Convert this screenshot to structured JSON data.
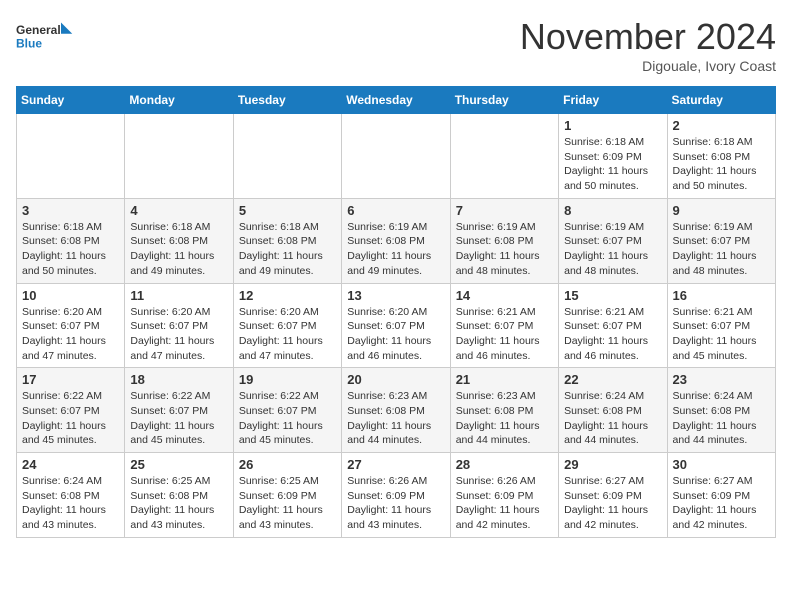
{
  "header": {
    "logo_line1": "General",
    "logo_line2": "Blue",
    "month": "November 2024",
    "location": "Digouale, Ivory Coast"
  },
  "days_of_week": [
    "Sunday",
    "Monday",
    "Tuesday",
    "Wednesday",
    "Thursday",
    "Friday",
    "Saturday"
  ],
  "weeks": [
    [
      {
        "day": "",
        "info": ""
      },
      {
        "day": "",
        "info": ""
      },
      {
        "day": "",
        "info": ""
      },
      {
        "day": "",
        "info": ""
      },
      {
        "day": "",
        "info": ""
      },
      {
        "day": "1",
        "info": "Sunrise: 6:18 AM\nSunset: 6:09 PM\nDaylight: 11 hours\nand 50 minutes."
      },
      {
        "day": "2",
        "info": "Sunrise: 6:18 AM\nSunset: 6:08 PM\nDaylight: 11 hours\nand 50 minutes."
      }
    ],
    [
      {
        "day": "3",
        "info": "Sunrise: 6:18 AM\nSunset: 6:08 PM\nDaylight: 11 hours\nand 50 minutes."
      },
      {
        "day": "4",
        "info": "Sunrise: 6:18 AM\nSunset: 6:08 PM\nDaylight: 11 hours\nand 49 minutes."
      },
      {
        "day": "5",
        "info": "Sunrise: 6:18 AM\nSunset: 6:08 PM\nDaylight: 11 hours\nand 49 minutes."
      },
      {
        "day": "6",
        "info": "Sunrise: 6:19 AM\nSunset: 6:08 PM\nDaylight: 11 hours\nand 49 minutes."
      },
      {
        "day": "7",
        "info": "Sunrise: 6:19 AM\nSunset: 6:08 PM\nDaylight: 11 hours\nand 48 minutes."
      },
      {
        "day": "8",
        "info": "Sunrise: 6:19 AM\nSunset: 6:07 PM\nDaylight: 11 hours\nand 48 minutes."
      },
      {
        "day": "9",
        "info": "Sunrise: 6:19 AM\nSunset: 6:07 PM\nDaylight: 11 hours\nand 48 minutes."
      }
    ],
    [
      {
        "day": "10",
        "info": "Sunrise: 6:20 AM\nSunset: 6:07 PM\nDaylight: 11 hours\nand 47 minutes."
      },
      {
        "day": "11",
        "info": "Sunrise: 6:20 AM\nSunset: 6:07 PM\nDaylight: 11 hours\nand 47 minutes."
      },
      {
        "day": "12",
        "info": "Sunrise: 6:20 AM\nSunset: 6:07 PM\nDaylight: 11 hours\nand 47 minutes."
      },
      {
        "day": "13",
        "info": "Sunrise: 6:20 AM\nSunset: 6:07 PM\nDaylight: 11 hours\nand 46 minutes."
      },
      {
        "day": "14",
        "info": "Sunrise: 6:21 AM\nSunset: 6:07 PM\nDaylight: 11 hours\nand 46 minutes."
      },
      {
        "day": "15",
        "info": "Sunrise: 6:21 AM\nSunset: 6:07 PM\nDaylight: 11 hours\nand 46 minutes."
      },
      {
        "day": "16",
        "info": "Sunrise: 6:21 AM\nSunset: 6:07 PM\nDaylight: 11 hours\nand 45 minutes."
      }
    ],
    [
      {
        "day": "17",
        "info": "Sunrise: 6:22 AM\nSunset: 6:07 PM\nDaylight: 11 hours\nand 45 minutes."
      },
      {
        "day": "18",
        "info": "Sunrise: 6:22 AM\nSunset: 6:07 PM\nDaylight: 11 hours\nand 45 minutes."
      },
      {
        "day": "19",
        "info": "Sunrise: 6:22 AM\nSunset: 6:07 PM\nDaylight: 11 hours\nand 45 minutes."
      },
      {
        "day": "20",
        "info": "Sunrise: 6:23 AM\nSunset: 6:08 PM\nDaylight: 11 hours\nand 44 minutes."
      },
      {
        "day": "21",
        "info": "Sunrise: 6:23 AM\nSunset: 6:08 PM\nDaylight: 11 hours\nand 44 minutes."
      },
      {
        "day": "22",
        "info": "Sunrise: 6:24 AM\nSunset: 6:08 PM\nDaylight: 11 hours\nand 44 minutes."
      },
      {
        "day": "23",
        "info": "Sunrise: 6:24 AM\nSunset: 6:08 PM\nDaylight: 11 hours\nand 44 minutes."
      }
    ],
    [
      {
        "day": "24",
        "info": "Sunrise: 6:24 AM\nSunset: 6:08 PM\nDaylight: 11 hours\nand 43 minutes."
      },
      {
        "day": "25",
        "info": "Sunrise: 6:25 AM\nSunset: 6:08 PM\nDaylight: 11 hours\nand 43 minutes."
      },
      {
        "day": "26",
        "info": "Sunrise: 6:25 AM\nSunset: 6:09 PM\nDaylight: 11 hours\nand 43 minutes."
      },
      {
        "day": "27",
        "info": "Sunrise: 6:26 AM\nSunset: 6:09 PM\nDaylight: 11 hours\nand 43 minutes."
      },
      {
        "day": "28",
        "info": "Sunrise: 6:26 AM\nSunset: 6:09 PM\nDaylight: 11 hours\nand 42 minutes."
      },
      {
        "day": "29",
        "info": "Sunrise: 6:27 AM\nSunset: 6:09 PM\nDaylight: 11 hours\nand 42 minutes."
      },
      {
        "day": "30",
        "info": "Sunrise: 6:27 AM\nSunset: 6:09 PM\nDaylight: 11 hours\nand 42 minutes."
      }
    ]
  ]
}
